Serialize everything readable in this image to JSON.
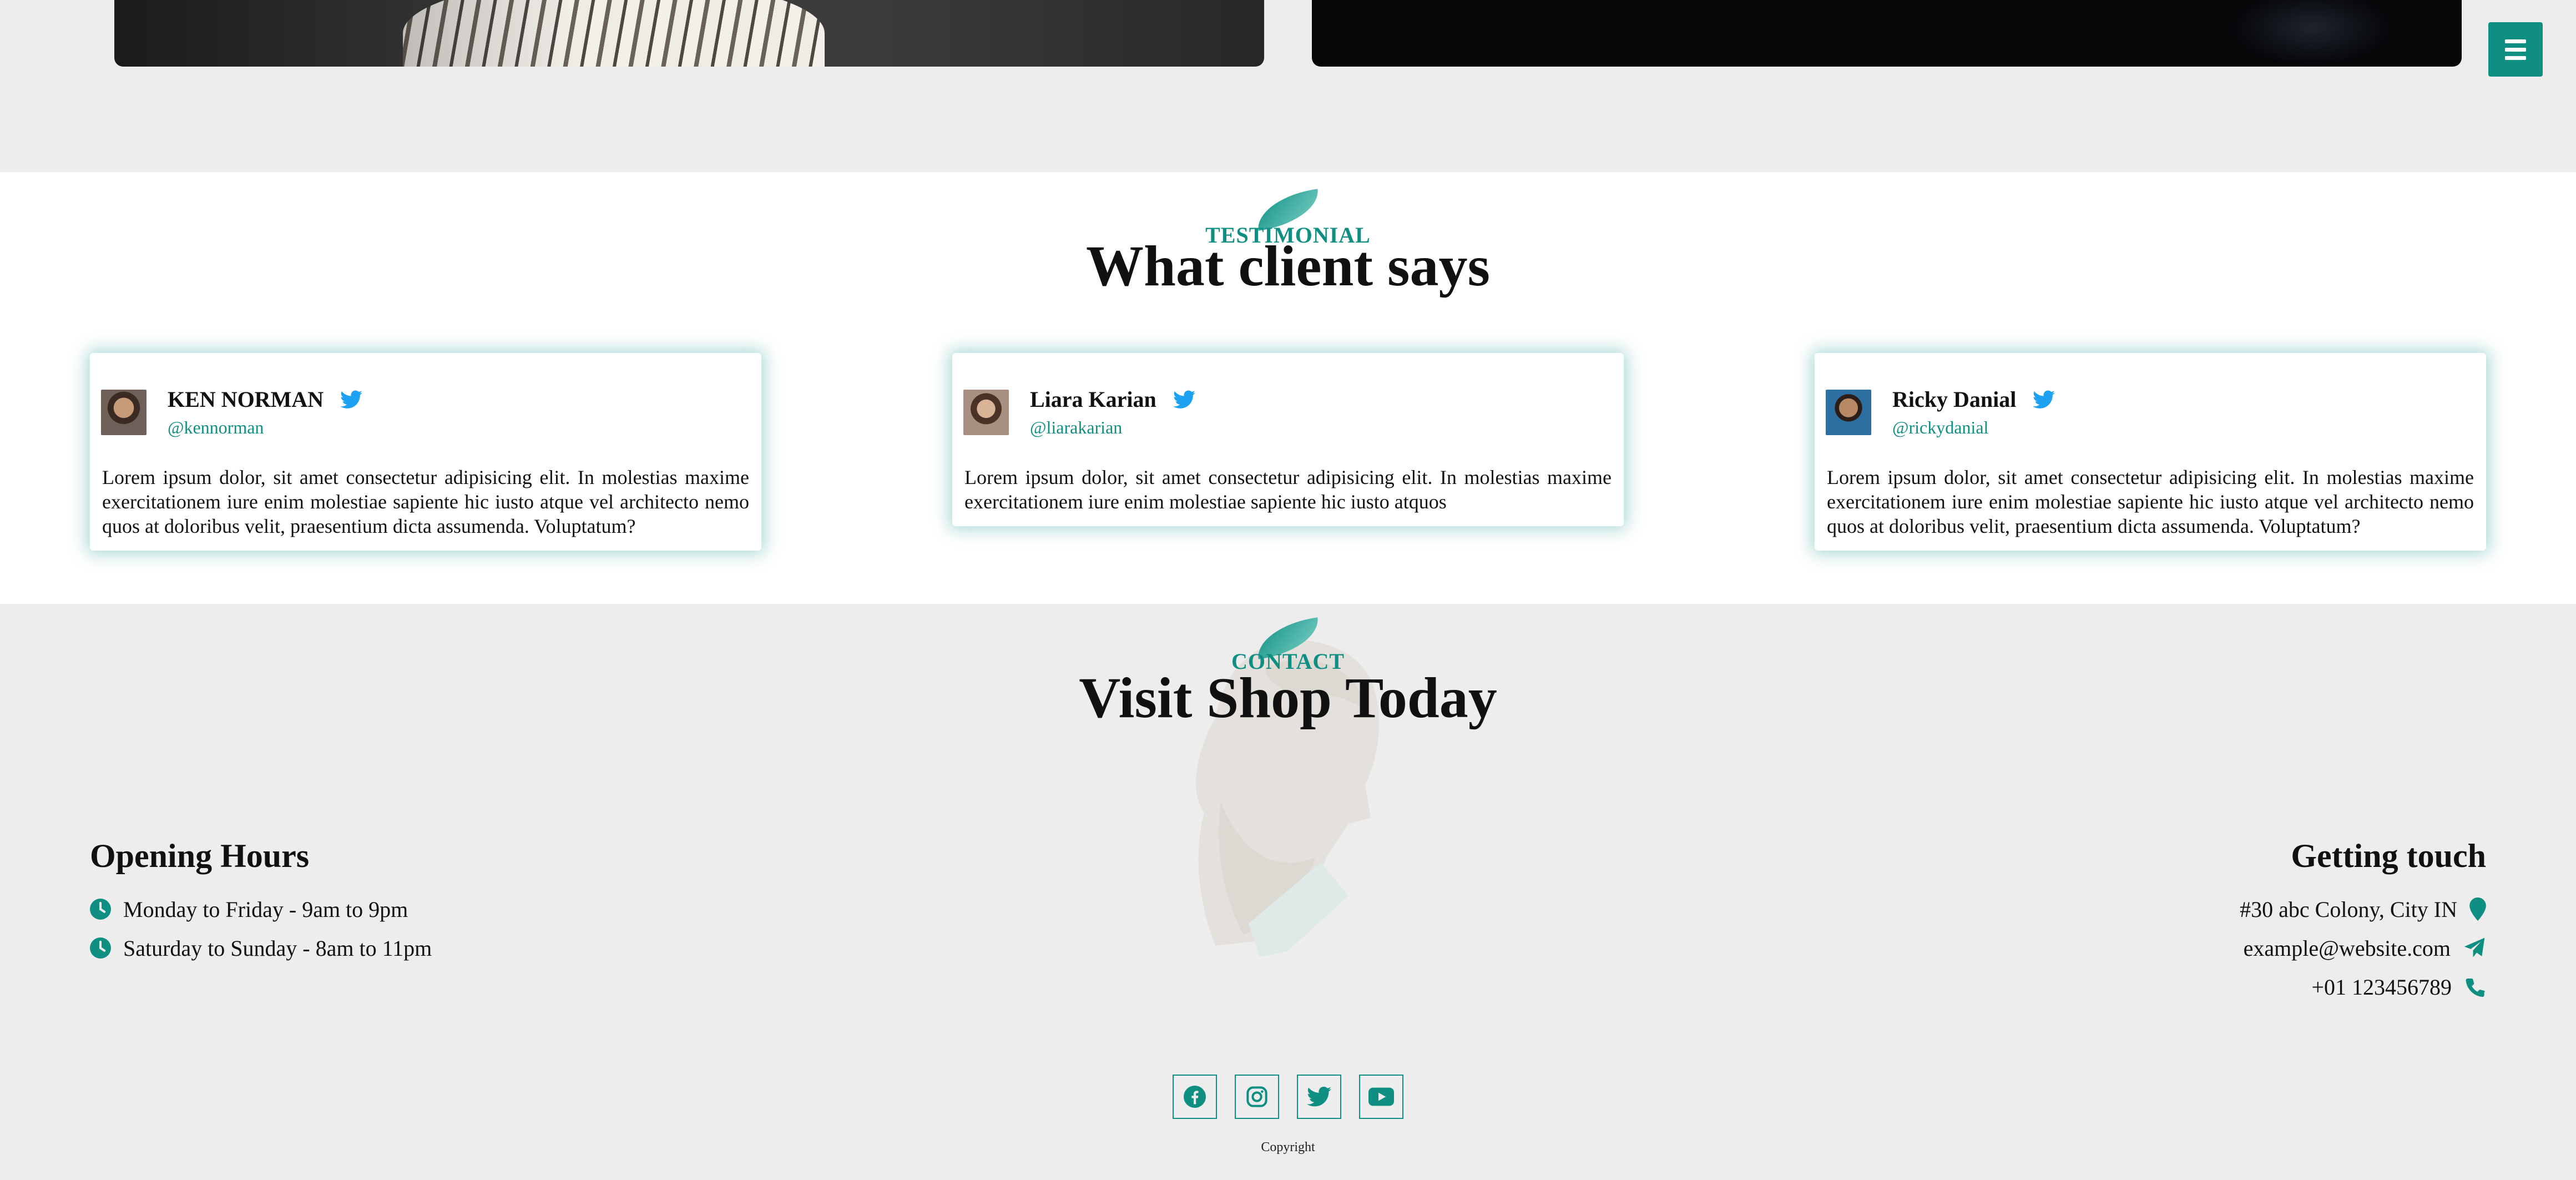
{
  "colors": {
    "accent": "#0e8f82",
    "twitter": "#1da1f2",
    "section_bg": "#ededed",
    "card_bg": "#ffffff"
  },
  "menu": {
    "icon": "hamburger-icon"
  },
  "testimonial": {
    "eyebrow": "TESTIMONIAL",
    "title": "What client says",
    "cards": [
      {
        "name": "KEN NORMAN",
        "handle": "@kennorman",
        "icon": "twitter-icon",
        "text": "Lorem ipsum dolor, sit amet consectetur adipisicing elit. In molestias maxime exercitationem iure enim molestiae sapiente hic iusto atque vel architecto nemo quos at doloribus velit, praesentium dicta assumenda. Voluptatum?"
      },
      {
        "name": "Liara Karian",
        "handle": "@liarakarian",
        "icon": "twitter-icon",
        "text": "Lorem ipsum dolor, sit amet consectetur adipisicing elit. In molestias maxime exercitationem iure enim molestiae sapiente hic iusto atquos"
      },
      {
        "name": "Ricky Danial",
        "handle": "@rickydanial",
        "icon": "twitter-icon",
        "text": "Lorem ipsum dolor, sit amet consectetur adipisicing elit. In molestias maxime exercitationem iure enim molestiae sapiente hic iusto atque vel architecto nemo quos at doloribus velit, praesentium dicta assumenda. Voluptatum?"
      }
    ]
  },
  "contact": {
    "eyebrow": "CONTACT",
    "title": "Visit Shop Today",
    "opening": {
      "title": "Opening Hours",
      "rows": [
        {
          "icon": "clock-icon",
          "text": "Monday to Friday - 9am to 9pm"
        },
        {
          "icon": "clock-icon",
          "text": "Saturday to Sunday - 8am to 11pm"
        }
      ]
    },
    "touch": {
      "title": "Getting touch",
      "address": {
        "icon": "map-pin-icon",
        "text": "#30 abc Colony, City IN"
      },
      "email": {
        "icon": "paper-plane-icon",
        "text": "example@website.com"
      },
      "phone": {
        "icon": "phone-icon",
        "text": "+01 123456789"
      }
    },
    "socials": [
      "facebook-icon",
      "instagram-icon",
      "twitter-icon",
      "youtube-icon"
    ],
    "copyright": "Copyright"
  }
}
